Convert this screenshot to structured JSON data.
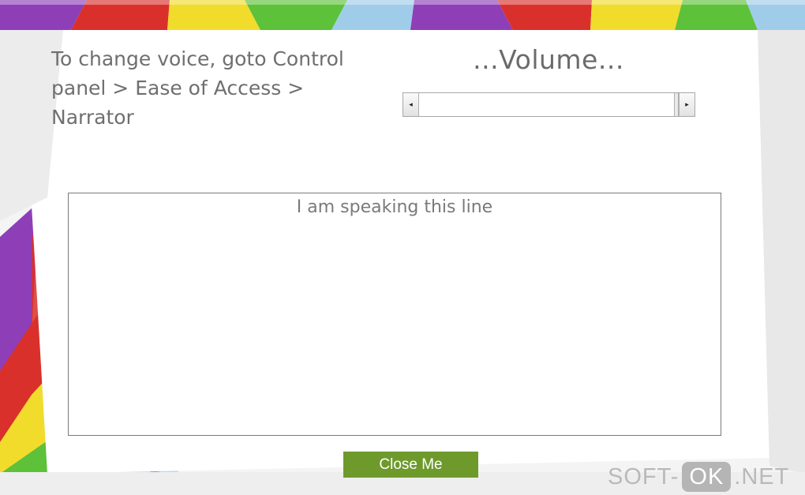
{
  "instructions": "To change voice, goto Control\npanel  > Ease of Access >\nNarrator",
  "volume": {
    "title": "...Volume...",
    "left_arrow": "◂",
    "right_arrow": "▸",
    "level": 0
  },
  "speech": {
    "text": "I am speaking this line"
  },
  "close_button": {
    "label": "Close Me"
  },
  "watermark": {
    "prefix": "SOFT-",
    "highlight": "OK",
    "suffix": ".NET"
  },
  "colors": {
    "tile_colors": [
      "#8b3fb5",
      "#d62c2c",
      "#f2dc2a",
      "#5cc23b",
      "#9dcbe8"
    ],
    "close_button_bg": "#6e9a2c"
  }
}
